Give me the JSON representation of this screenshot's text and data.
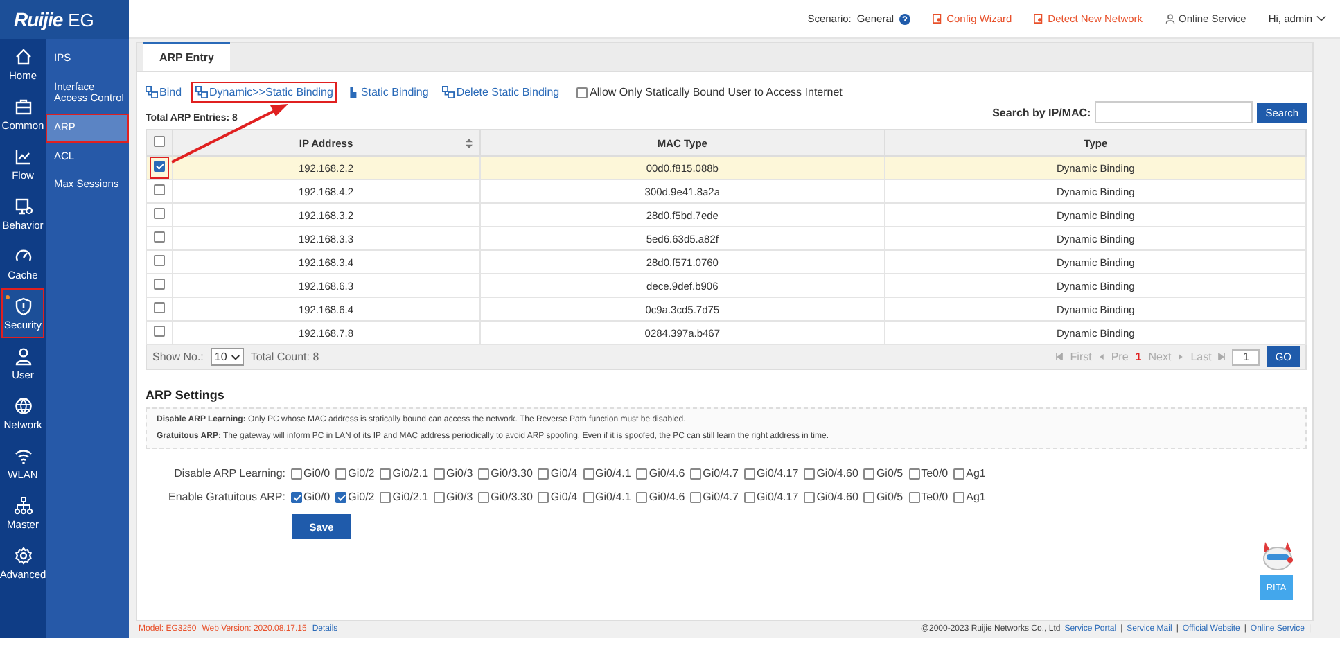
{
  "brand": {
    "logo": "Ruijie",
    "product": "EG"
  },
  "topbar": {
    "scenario_label": "Scenario:",
    "scenario": "General",
    "links": [
      {
        "label": "Config Wizard",
        "kind": "alert"
      },
      {
        "label": "Detect New Network",
        "kind": "alert"
      },
      {
        "label": "Online Service",
        "kind": "user"
      }
    ],
    "user": "Hi, admin"
  },
  "nav": [
    {
      "label": "Home",
      "kind": "home",
      "selected": false,
      "highlighted": false,
      "dot": false
    },
    {
      "label": "Common",
      "kind": "briefcase",
      "selected": false,
      "highlighted": false,
      "dot": false
    },
    {
      "label": "Flow",
      "kind": "chart",
      "selected": false,
      "highlighted": false,
      "dot": false
    },
    {
      "label": "Behavior",
      "kind": "monitor",
      "selected": false,
      "highlighted": false,
      "dot": false
    },
    {
      "label": "Cache",
      "kind": "gauge",
      "selected": false,
      "highlighted": false,
      "dot": false
    },
    {
      "label": "Security",
      "kind": "shield",
      "selected": true,
      "highlighted": true,
      "dot": true
    },
    {
      "label": "User",
      "kind": "user",
      "selected": false,
      "highlighted": false,
      "dot": false
    },
    {
      "label": "Network",
      "kind": "globe",
      "selected": false,
      "highlighted": false,
      "dot": false
    },
    {
      "label": "WLAN",
      "kind": "wifi",
      "selected": false,
      "highlighted": false,
      "dot": false
    },
    {
      "label": "Master",
      "kind": "tree",
      "selected": false,
      "highlighted": false,
      "dot": false
    },
    {
      "label": "Advanced",
      "kind": "gear",
      "selected": false,
      "highlighted": false,
      "dot": false
    }
  ],
  "subnav": [
    {
      "label": "IPS",
      "selected": false,
      "highlighted": false
    },
    {
      "label": "Interface Access Control",
      "selected": false,
      "highlighted": false
    },
    {
      "label": "ARP",
      "selected": true,
      "highlighted": true
    },
    {
      "label": "ACL",
      "selected": false,
      "highlighted": false
    },
    {
      "label": "Max Sessions",
      "selected": false,
      "highlighted": false
    }
  ],
  "tabs": [
    {
      "label": "ARP Entry",
      "selected": true
    }
  ],
  "actions": [
    {
      "label": "Bind",
      "highlighted": false
    },
    {
      "label": "Dynamic>>Static Binding",
      "highlighted": true
    },
    {
      "label": "Static Binding",
      "highlighted": false
    },
    {
      "label": "Delete Static Binding",
      "highlighted": false
    }
  ],
  "allow_only_static": {
    "label": "Allow Only Statically Bound User to Access Internet",
    "checked": false
  },
  "total_entries": {
    "label": "Total ARP Entries:",
    "value": "8"
  },
  "search": {
    "label": "Search by IP/MAC:",
    "button": "Search"
  },
  "table": {
    "header_checked": false,
    "columns": [
      {
        "label": "IP Address",
        "sortable": true
      },
      {
        "label": "MAC Type",
        "sortable": false
      },
      {
        "label": "Type",
        "sortable": false
      }
    ],
    "rows": [
      {
        "ip": "192.168.2.2",
        "mac": "00d0.f815.088b",
        "type": "Dynamic Binding",
        "selected": true,
        "highlighted": true
      },
      {
        "ip": "192.168.4.2",
        "mac": "300d.9e41.8a2a",
        "type": "Dynamic Binding",
        "selected": false,
        "highlighted": false
      },
      {
        "ip": "192.168.3.2",
        "mac": "28d0.f5bd.7ede",
        "type": "Dynamic Binding",
        "selected": false,
        "highlighted": false
      },
      {
        "ip": "192.168.3.3",
        "mac": "5ed6.63d5.a82f",
        "type": "Dynamic Binding",
        "selected": false,
        "highlighted": false
      },
      {
        "ip": "192.168.3.4",
        "mac": "28d0.f571.0760",
        "type": "Dynamic Binding",
        "selected": false,
        "highlighted": false
      },
      {
        "ip": "192.168.6.3",
        "mac": "dece.9def.b906",
        "type": "Dynamic Binding",
        "selected": false,
        "highlighted": false
      },
      {
        "ip": "192.168.6.4",
        "mac": "0c9a.3cd5.7d75",
        "type": "Dynamic Binding",
        "selected": false,
        "highlighted": false
      },
      {
        "ip": "192.168.7.8",
        "mac": "0284.397a.b467",
        "type": "Dynamic Binding",
        "selected": false,
        "highlighted": false
      }
    ]
  },
  "pagination": {
    "show_label": "Show No.:",
    "page_size": "10",
    "total": "Total Count: 8",
    "first": "First",
    "pre": "Pre",
    "current": "1",
    "next": "Next",
    "last": "Last",
    "page_input": "1",
    "go": "GO"
  },
  "settings": {
    "title": "ARP Settings",
    "notes": [
      "**Disable ARP Learning:** Only PC whose MAC address is statically bound can access the network. The Reverse Path function must be disabled.",
      "**Gratuitous ARP:** The gateway will inform PC in LAN of its IP and MAC address periodically to avoid ARP spoofing. Even if it is spoofed, the PC can still learn the right address in time."
    ],
    "rows": [
      {
        "label": "Disable ARP Learning:",
        "ports": [
          {
            "name": "Gi0/0",
            "checked": false
          },
          {
            "name": "Gi0/2",
            "checked": false
          },
          {
            "name": "Gi0/2.1",
            "checked": false
          },
          {
            "name": "Gi0/3",
            "checked": false
          },
          {
            "name": "Gi0/3.30",
            "checked": false
          },
          {
            "name": "Gi0/4",
            "checked": false
          },
          {
            "name": "Gi0/4.1",
            "checked": false
          },
          {
            "name": "Gi0/4.6",
            "checked": false
          },
          {
            "name": "Gi0/4.7",
            "checked": false
          },
          {
            "name": "Gi0/4.17",
            "checked": false
          },
          {
            "name": "Gi0/4.60",
            "checked": false
          },
          {
            "name": "Gi0/5",
            "checked": false
          },
          {
            "name": "Te0/0",
            "checked": false
          },
          {
            "name": "Ag1",
            "checked": false
          }
        ]
      },
      {
        "label": "Enable Gratuitous ARP:",
        "ports": [
          {
            "name": "Gi0/0",
            "checked": true
          },
          {
            "name": "Gi0/2",
            "checked": true
          },
          {
            "name": "Gi0/2.1",
            "checked": false
          },
          {
            "name": "Gi0/3",
            "checked": false
          },
          {
            "name": "Gi0/3.30",
            "checked": false
          },
          {
            "name": "Gi0/4",
            "checked": false
          },
          {
            "name": "Gi0/4.1",
            "checked": false
          },
          {
            "name": "Gi0/4.6",
            "checked": false
          },
          {
            "name": "Gi0/4.7",
            "checked": false
          },
          {
            "name": "Gi0/4.17",
            "checked": false
          },
          {
            "name": "Gi0/4.60",
            "checked": false
          },
          {
            "name": "Gi0/5",
            "checked": false
          },
          {
            "name": "Te0/0",
            "checked": false
          },
          {
            "name": "Ag1",
            "checked": false
          }
        ]
      }
    ],
    "save": "Save"
  },
  "assistant": {
    "label": "RITA"
  },
  "footer": {
    "model_label": "Model:",
    "model": "EG3250",
    "version_label": "Web Version:",
    "version": "2020.08.17.15",
    "details": "Details",
    "copyright": "@2000-2023 Ruijie Networks Co., Ltd",
    "separator": "|",
    "links": [
      "Service Portal",
      "Service Mail",
      "Official Website",
      "Online Service"
    ]
  }
}
